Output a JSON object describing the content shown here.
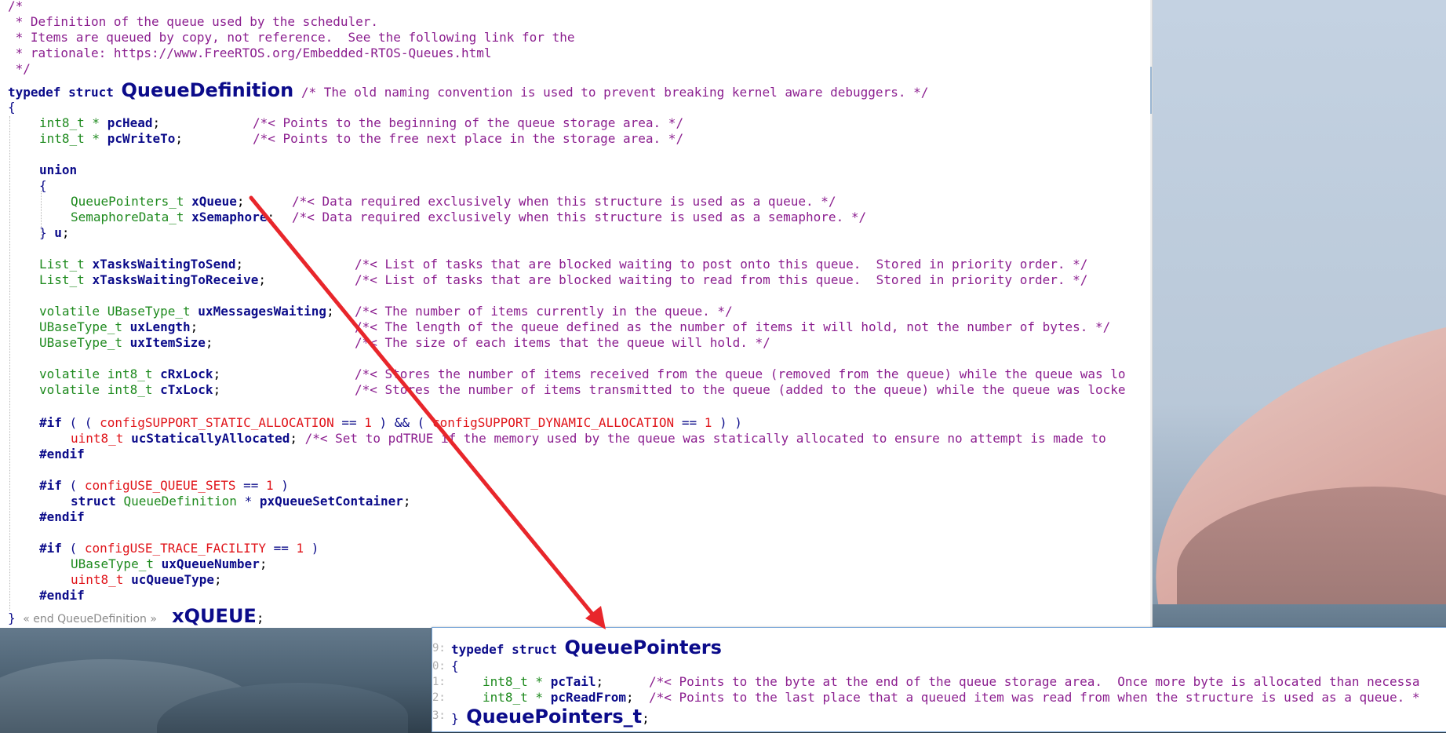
{
  "main_editor": {
    "header_comment": [
      "/*",
      " * Definition of the queue used by the scheduler.",
      " * Items are queued by copy, not reference.  See the following link for the",
      " * rationale: https://www.FreeRTOS.org/Embedded-RTOS-Queues.html",
      " */"
    ],
    "typedef_kw": "typedef struct ",
    "struct_name": "QueueDefinition",
    "struct_comment": " /* The old naming convention is used to prevent breaking kernel aware debuggers. */",
    "open_brace": "{",
    "pchead_type": "int8_t * ",
    "pchead_name": "pcHead",
    "pchead_punct": ";",
    "pchead_comment": "/*< Points to the beginning of the queue storage area. */",
    "pcwriteto_type": "int8_t * ",
    "pcwriteto_name": "pcWriteTo",
    "pcwriteto_punct": ";",
    "pcwriteto_comment": "/*< Points to the free next place in the storage area. */",
    "union_kw": "union",
    "union_open": "{",
    "xqueue_type": "QueuePointers_t ",
    "xqueue_name": "xQueue",
    "xqueue_punct": ";",
    "xqueue_comment": "/*< Data required exclusively when this structure is used as a queue. */",
    "xsem_type": "SemaphoreData_t ",
    "xsem_name": "xSemaphore",
    "xsem_punct": ";",
    "xsem_comment": "/*< Data required exclusively when this structure is used as a semaphore. */",
    "union_close_brace": "} ",
    "union_close_name": "u",
    "union_close_punct": ";",
    "send_type": "List_t ",
    "send_name": "xTasksWaitingToSend",
    "send_punct": ";",
    "send_comment": "/*< List of tasks that are blocked waiting to post onto this queue.  Stored in priority order. */",
    "recv_type": "List_t ",
    "recv_name": "xTasksWaitingToReceive",
    "recv_punct": ";",
    "recv_comment": "/*< List of tasks that are blocked waiting to read from this queue.  Stored in priority order. */",
    "msgs_type": "volatile UBaseType_t ",
    "msgs_name": "uxMessagesWaiting",
    "msgs_punct": ";",
    "msgs_comment": "/*< The number of items currently in the queue. */",
    "len_type": "UBaseType_t ",
    "len_name": "uxLength",
    "len_punct": ";",
    "len_comment": "/*< The length of the queue defined as the number of items it will hold, not the number of bytes. */",
    "isz_type": "UBaseType_t ",
    "isz_name": "uxItemSize",
    "isz_punct": ";",
    "isz_comment": "/*< The size of each items that the queue will hold. */",
    "rx_type": "volatile int8_t ",
    "rx_name": "cRxLock",
    "rx_punct": ";",
    "rx_comment": "/*< Stores the number of items received from the queue (removed from the queue) while the queue was lo",
    "tx_type": "volatile int8_t ",
    "tx_name": "cTxLock",
    "tx_punct": ";",
    "tx_comment": "/*< Stores the number of items transmitted to the queue (added to the queue) while the queue was locke",
    "if1_kw": "#if",
    "if1_open": " ( ( ",
    "if1_macro1": "configSUPPORT_STATIC_ALLOCATION",
    "if1_eq1": " == ",
    "if1_num1": "1",
    "if1_mid": " ) && ( ",
    "if1_macro2": "configSUPPORT_DYNAMIC_ALLOCATION",
    "if1_eq2": " == ",
    "if1_num2": "1",
    "if1_close": " ) )",
    "static_type": "uint8_t ",
    "static_name": "ucStaticallyAllocated",
    "static_punct": "; ",
    "static_comment": "/*< Set to pdTRUE if the memory used by the queue was statically allocated to ensure no attempt is made to",
    "endif1": "#endif",
    "if2_kw": "#if",
    "if2_open": " ( ",
    "if2_macro": "configUSE_QUEUE_SETS",
    "if2_eq": " == ",
    "if2_num": "1",
    "if2_close": " )",
    "set_kw": "struct ",
    "set_type": "QueueDefinition",
    "set_star": " * ",
    "set_name": "pxQueueSetContainer",
    "set_punct": ";",
    "endif2": "#endif",
    "if3_kw": "#if",
    "if3_open": " ( ",
    "if3_macro": "configUSE_TRACE_FACILITY",
    "if3_eq": " == ",
    "if3_num": "1",
    "if3_close": " )",
    "qnum_type": "UBaseType_t ",
    "qnum_name": "uxQueueNumber",
    "qnum_punct": ";",
    "qtype_type": "uint8_t ",
    "qtype_name": "ucQueueType",
    "qtype_punct": ";",
    "endif3": "#endif",
    "close_brace": "} ",
    "fold_label": "« end QueueDefinition »",
    "typedef_name": "xQUEUE",
    "typedef_punct": ";"
  },
  "popup_editor": {
    "gutter": [
      "9:",
      "0:",
      "1:",
      "2:",
      "3:"
    ],
    "typedef_kw": "typedef struct ",
    "struct_name": "QueuePointers",
    "open_brace": "{",
    "tail_type": "int8_t * ",
    "tail_name": "pcTail",
    "tail_punct": ";",
    "tail_comment": "/*< Points to the byte at the end of the queue storage area.  Once more byte is allocated than necessa",
    "read_type": "int8_t * ",
    "read_name": "pcReadFrom",
    "read_punct": ";",
    "read_comment": "/*< Points to the last place that a queued item was read from when the structure is used as a queue. *",
    "close_brace": "} ",
    "typedef_name": "QueuePointers_t",
    "typedef_punct": ";"
  },
  "annotation": {
    "arrow_color": "#e8262b"
  },
  "colors": {
    "comment": "#8b1e8f",
    "type": "#1e8a1e",
    "identifier": "#0b0b8a",
    "macro": "#e0141a"
  }
}
